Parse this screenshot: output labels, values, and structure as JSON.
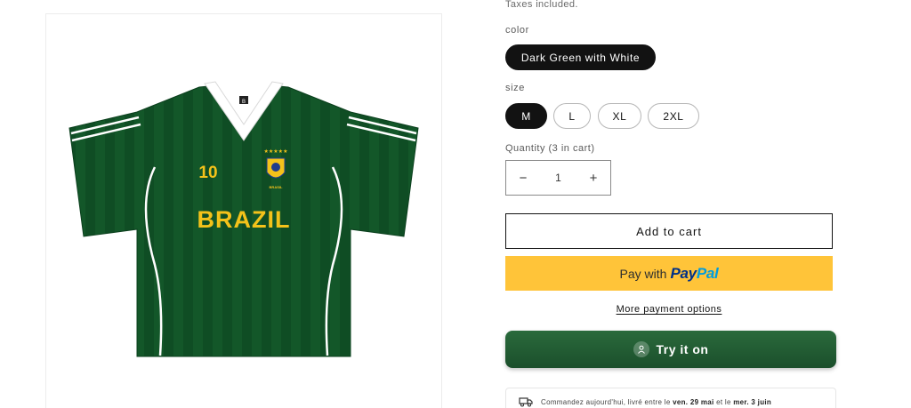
{
  "product": {
    "taxes_note": "Taxes included.",
    "image_alt": "Green Brazil football jersey"
  },
  "jersey_print": {
    "number": "10",
    "team_text": "BRAZIL",
    "crest_text": "BRASIL",
    "collar_tag": "B"
  },
  "color": {
    "label": "color",
    "options": [
      {
        "label": "Dark Green with White",
        "selected": true
      }
    ]
  },
  "size": {
    "label": "size",
    "options": [
      {
        "label": "M",
        "selected": true
      },
      {
        "label": "L",
        "selected": false
      },
      {
        "label": "XL",
        "selected": false
      },
      {
        "label": "2XL",
        "selected": false
      }
    ]
  },
  "quantity": {
    "label": "Quantity (3 in cart)",
    "value": "1",
    "decrease_symbol": "−",
    "increase_symbol": "+"
  },
  "buttons": {
    "add_to_cart": "Add to cart",
    "paypal_prefix": "Pay with",
    "paypal_brand_part1": "Pay",
    "paypal_brand_part2": "Pal",
    "more_payment_options": "More payment options",
    "try_it_on": "Try it on"
  },
  "delivery": {
    "icon": "truck-icon",
    "text_prefix": "Commandez aujourd'hui, livré entre le ",
    "date_start": "ven. 29 mai",
    "text_middle": " et le ",
    "date_end": "mer. 3 juin"
  },
  "colors": {
    "selected_pill": "#121212",
    "paypal_yellow": "#ffc439",
    "paypal_dark_blue": "#003087",
    "paypal_light_blue": "#009cde",
    "try_on_green": "#1f5a32",
    "jersey_green": "#0f4d24",
    "jersey_yellow": "#f4c21a"
  }
}
